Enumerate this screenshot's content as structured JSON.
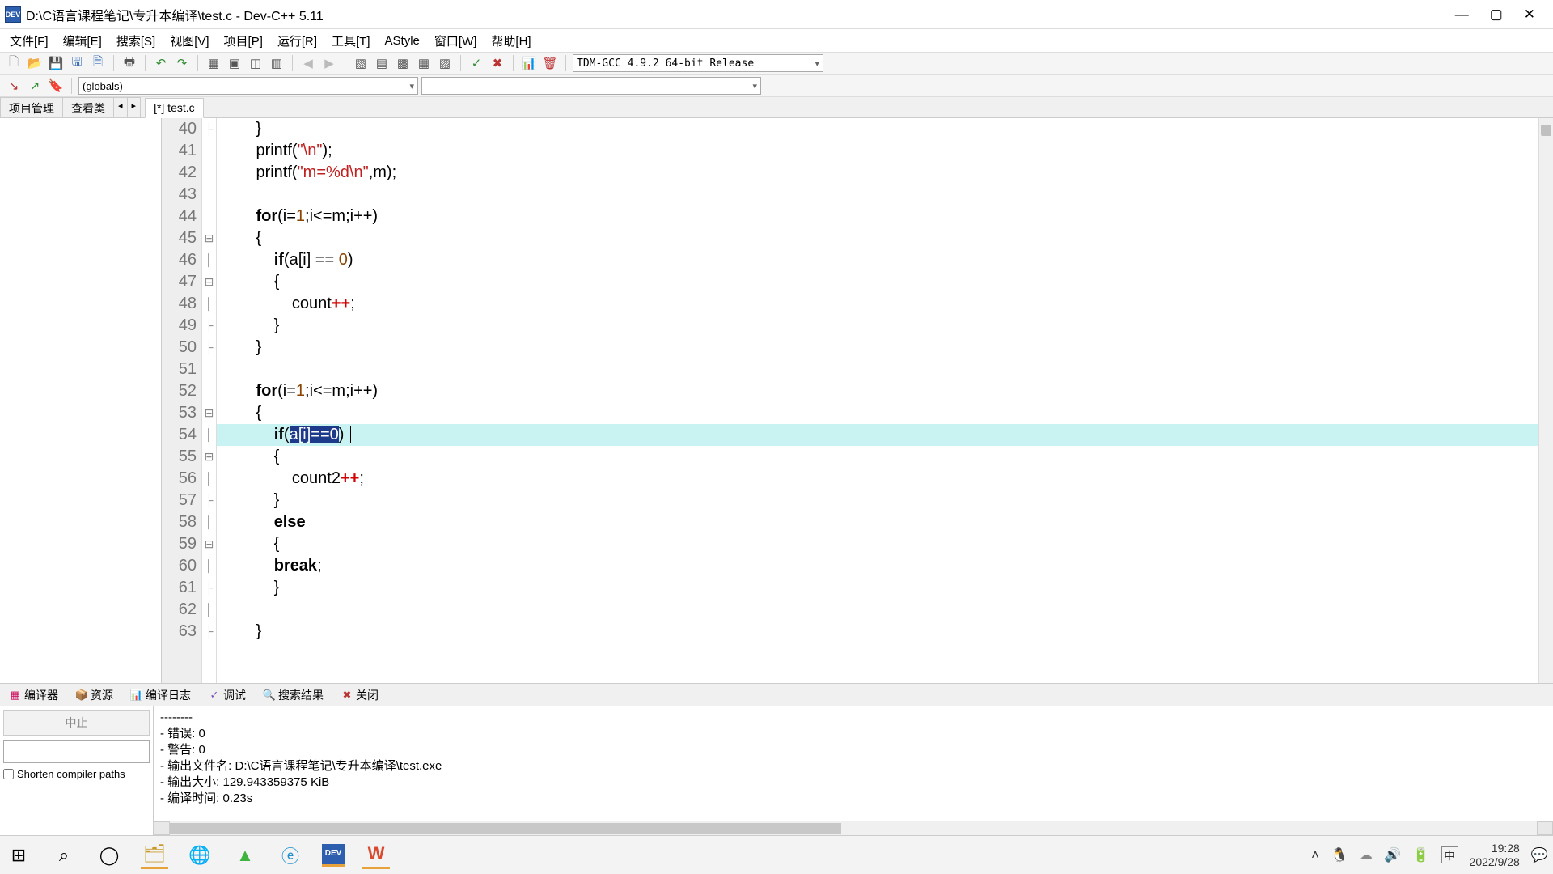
{
  "window": {
    "title": "D:\\C语言课程笔记\\专升本编译\\test.c - Dev-C++ 5.11"
  },
  "menu": {
    "file": "文件[F]",
    "edit": "编辑[E]",
    "search": "搜索[S]",
    "view": "视图[V]",
    "project": "项目[P]",
    "run": "运行[R]",
    "tools": "工具[T]",
    "astyle": "AStyle",
    "window": "窗口[W]",
    "help": "帮助[H]"
  },
  "toolbar": {
    "compiler_combo": "TDM-GCC 4.9.2 64-bit Release",
    "globals_combo": "(globals)"
  },
  "side_tabs": {
    "project": "项目管理",
    "classes": "查看类"
  },
  "editor_tab": {
    "name": "[*] test.c"
  },
  "code": {
    "first_line": 40,
    "lines": [
      {
        "n": 40,
        "fold": "├",
        "ind": "        ",
        "html": "}"
      },
      {
        "n": 41,
        "fold": " ",
        "ind": "        ",
        "html": "printf(<span class='str'>\"\\n\"</span>);"
      },
      {
        "n": 42,
        "fold": " ",
        "ind": "        ",
        "html": "printf(<span class='str'>\"m=%d\\n\"</span>,m);"
      },
      {
        "n": 43,
        "fold": " ",
        "ind": "",
        "html": ""
      },
      {
        "n": 44,
        "fold": " ",
        "ind": "        ",
        "html": "<span class='kw'>for</span>(i=<span class='num'>1</span>;i<=m;i++)"
      },
      {
        "n": 45,
        "fold": "⊟",
        "ind": "        ",
        "html": "{"
      },
      {
        "n": 46,
        "fold": "│",
        "ind": "            ",
        "html": "<span class='kw'>if</span>(a[i] == <span class='num'>0</span>)"
      },
      {
        "n": 47,
        "fold": "⊟",
        "ind": "            ",
        "html": "{"
      },
      {
        "n": 48,
        "fold": "│",
        "ind": "                ",
        "html": "count<span class='op'>++</span>;"
      },
      {
        "n": 49,
        "fold": "├",
        "ind": "            ",
        "html": "}"
      },
      {
        "n": 50,
        "fold": "├",
        "ind": "        ",
        "html": "}"
      },
      {
        "n": 51,
        "fold": " ",
        "ind": "",
        "html": ""
      },
      {
        "n": 52,
        "fold": " ",
        "ind": "        ",
        "html": "<span class='kw'>for</span>(i=<span class='num'>1</span>;i<=m;i++)"
      },
      {
        "n": 53,
        "fold": "⊟",
        "ind": "        ",
        "html": "{"
      },
      {
        "n": 54,
        "fold": "│",
        "ind": "            ",
        "hl": true,
        "html": "<span class='kw'>if</span>(<span class='sel'>a[i]==0</span>) <span class='cursor'></span>"
      },
      {
        "n": 55,
        "fold": "⊟",
        "ind": "            ",
        "html": "{"
      },
      {
        "n": 56,
        "fold": "│",
        "ind": "                ",
        "html": "count2<span class='op'>++</span>;"
      },
      {
        "n": 57,
        "fold": "├",
        "ind": "            ",
        "html": "}"
      },
      {
        "n": 58,
        "fold": "│",
        "ind": "            ",
        "html": "<span class='kw'>else</span>"
      },
      {
        "n": 59,
        "fold": "⊟",
        "ind": "            ",
        "html": "{"
      },
      {
        "n": 60,
        "fold": "│",
        "ind": "            ",
        "html": "<span class='kw'>break</span>;"
      },
      {
        "n": 61,
        "fold": "├",
        "ind": "            ",
        "html": "}"
      },
      {
        "n": 62,
        "fold": "│",
        "ind": "",
        "html": ""
      },
      {
        "n": 63,
        "fold": "├",
        "ind": "        ",
        "html": "}"
      }
    ]
  },
  "bottom_tabs": {
    "compiler": "编译器",
    "res": "资源",
    "log": "编译日志",
    "debug": "调试",
    "results": "搜索结果",
    "close": "关闭"
  },
  "bottom_panel": {
    "abort_btn": "中止",
    "shorten_label": "Shorten compiler paths",
    "output_lines": [
      "--------",
      "- 错误: 0",
      "- 警告: 0",
      "- 输出文件名: D:\\C语言课程笔记\\专升本编译\\test.exe",
      "- 输出大小: 129.943359375 KiB",
      "- 编译时间: 0.23s"
    ]
  },
  "taskbar": {
    "ime": "中",
    "time": "19:28",
    "date": "2022/9/28"
  }
}
